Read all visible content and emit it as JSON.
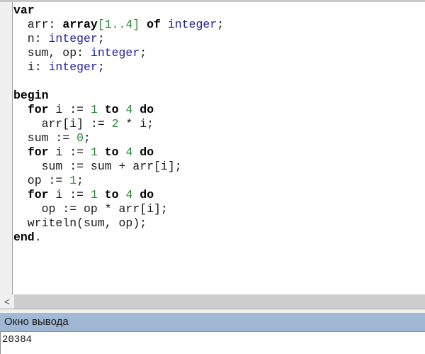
{
  "editor": {
    "lines": [
      [
        [
          "var",
          "kw"
        ]
      ],
      [
        [
          "  arr: ",
          ""
        ],
        [
          "array",
          "kw"
        ],
        [
          "[1..4]",
          "num"
        ],
        [
          " ",
          ""
        ],
        [
          "of",
          "kw"
        ],
        [
          " ",
          ""
        ],
        [
          "integer",
          "ty"
        ],
        [
          ";",
          ""
        ]
      ],
      [
        [
          "  n: ",
          ""
        ],
        [
          "integer",
          "ty"
        ],
        [
          ";",
          ""
        ]
      ],
      [
        [
          "  sum, op: ",
          ""
        ],
        [
          "integer",
          "ty"
        ],
        [
          ";",
          ""
        ]
      ],
      [
        [
          "  i: ",
          ""
        ],
        [
          "integer",
          "ty"
        ],
        [
          ";",
          ""
        ]
      ],
      [],
      [
        [
          "begin",
          "kw"
        ]
      ],
      [
        [
          "  ",
          ""
        ],
        [
          "for",
          "kw"
        ],
        [
          " i := ",
          ""
        ],
        [
          "1",
          "num"
        ],
        [
          " ",
          ""
        ],
        [
          "to",
          "kw"
        ],
        [
          " ",
          ""
        ],
        [
          "4",
          "num"
        ],
        [
          " ",
          ""
        ],
        [
          "do",
          "kw"
        ]
      ],
      [
        [
          "    arr[i] := ",
          ""
        ],
        [
          "2",
          "num"
        ],
        [
          " * i;",
          ""
        ]
      ],
      [
        [
          "  sum := ",
          ""
        ],
        [
          "0",
          "num"
        ],
        [
          ";",
          ""
        ]
      ],
      [
        [
          "  ",
          ""
        ],
        [
          "for",
          "kw"
        ],
        [
          " i := ",
          ""
        ],
        [
          "1",
          "num"
        ],
        [
          " ",
          ""
        ],
        [
          "to",
          "kw"
        ],
        [
          " ",
          ""
        ],
        [
          "4",
          "num"
        ],
        [
          " ",
          ""
        ],
        [
          "do",
          "kw"
        ]
      ],
      [
        [
          "    sum := sum + arr[i];",
          ""
        ]
      ],
      [
        [
          "  op := ",
          ""
        ],
        [
          "1",
          "num"
        ],
        [
          ";",
          ""
        ]
      ],
      [
        [
          "  ",
          ""
        ],
        [
          "for",
          "kw"
        ],
        [
          " i := ",
          ""
        ],
        [
          "1",
          "num"
        ],
        [
          " ",
          ""
        ],
        [
          "to",
          "kw"
        ],
        [
          " ",
          ""
        ],
        [
          "4",
          "num"
        ],
        [
          " ",
          ""
        ],
        [
          "do",
          "kw"
        ]
      ],
      [
        [
          "    op := op * arr[i];",
          ""
        ]
      ],
      [
        [
          "  writeln(sum, op);",
          ""
        ]
      ],
      [
        [
          "end",
          "kw"
        ],
        [
          ".",
          ""
        ]
      ]
    ]
  },
  "scrollbar": {
    "left_arrow": "<"
  },
  "output_panel": {
    "title": "Окно вывода",
    "text": "20384"
  }
}
